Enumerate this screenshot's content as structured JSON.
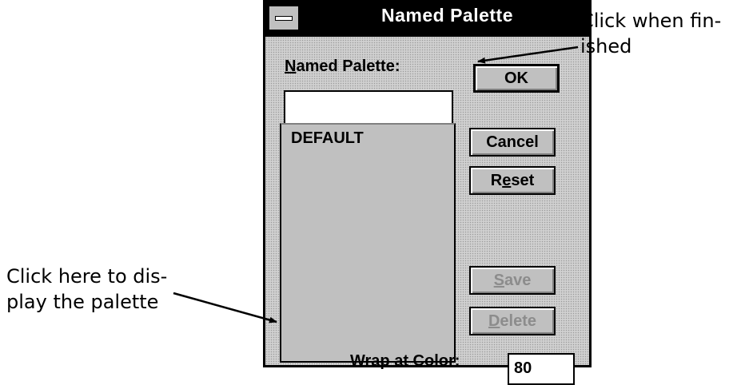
{
  "window": {
    "title": "Named Palette",
    "palette_label_accel": "N",
    "palette_label_rest": "amed Palette:",
    "name_input_value": "",
    "list_items": [
      "DEFAULT"
    ]
  },
  "buttons": {
    "ok": "OK",
    "cancel": "Cancel",
    "reset_pre": "R",
    "reset_accel": "e",
    "reset_post": "set",
    "save_accel": "S",
    "save_post": "ave",
    "delete_accel": "D",
    "delete_post": "elete"
  },
  "wrap": {
    "label": "Wrap at Color:",
    "value": "80"
  },
  "callouts": {
    "finished_line1": "Click when fin-",
    "finished_line2": "ished",
    "display_line1": "Click here to dis-",
    "display_line2": "play the palette"
  }
}
